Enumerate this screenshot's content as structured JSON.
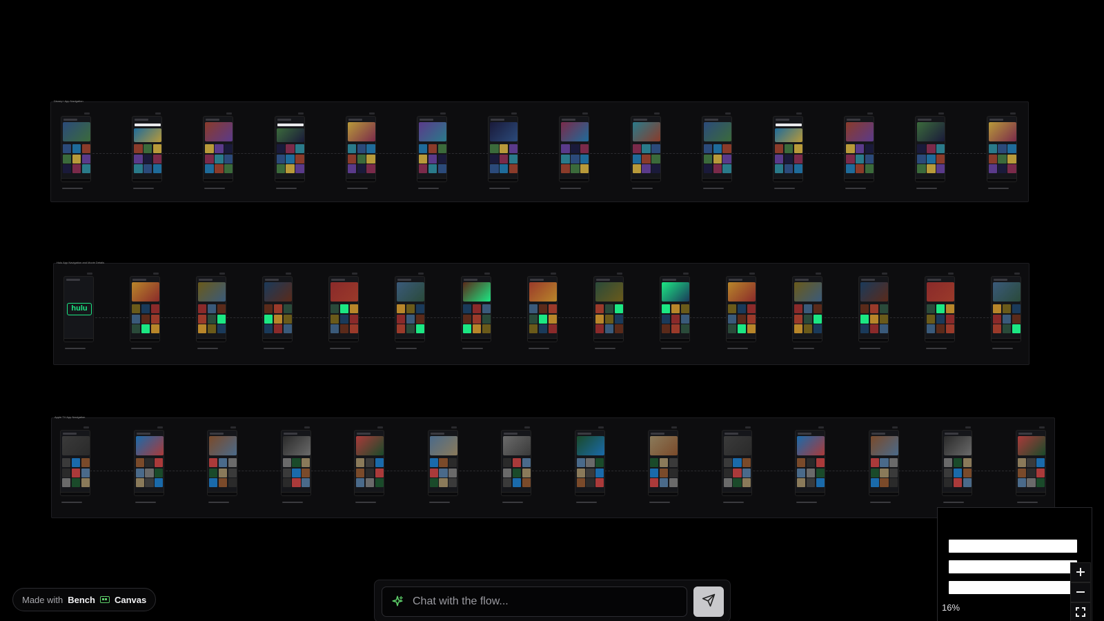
{
  "flows": [
    {
      "title": "Disney+ App Navigation",
      "screen_count": 14,
      "palette": [
        "#2b4a7a",
        "#1f6b9a",
        "#8a3b2a",
        "#3b6a3b",
        "#b89a3a",
        "#5a3a8a",
        "#1a1a3a",
        "#7a2a4a",
        "#2a7a8a"
      ]
    },
    {
      "title": "Hulu App Navigation and Movie Details",
      "screen_count": 15,
      "palette": [
        "#1ce783",
        "#b8862a",
        "#6a5a1a",
        "#1a3a5a",
        "#8a2a2a",
        "#3a5a7a",
        "#5a2a1a",
        "#9a3a2a",
        "#2a4a3a"
      ]
    },
    {
      "title": "Apple TV App Navigation",
      "screen_count": 14,
      "palette": [
        "#3a3a3a",
        "#1a6aaa",
        "#7a4a2a",
        "#2a2a2a",
        "#aa3a3a",
        "#4a6a8a",
        "#6a6a6a",
        "#1a4a2a",
        "#8a7a5a"
      ]
    }
  ],
  "badge": {
    "lead": "Made with",
    "brand_left": "Bench",
    "brand_right": "Canvas"
  },
  "chat": {
    "placeholder": "Chat with the flow...",
    "icon": "sparkle-icon",
    "send_icon": "send-icon"
  },
  "minimap": {
    "zoom": "16%",
    "zoom_in_icon": "plus-icon",
    "zoom_out_icon": "minus-icon",
    "fit_icon": "fit-view-icon"
  }
}
